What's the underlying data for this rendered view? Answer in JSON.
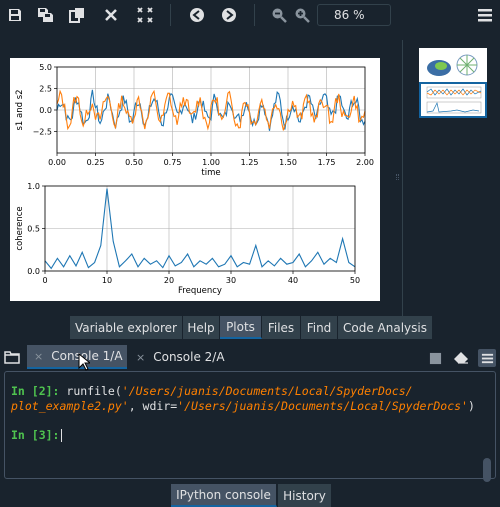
{
  "toolbar": {
    "icons": [
      "save-icon",
      "save-all-icon",
      "copy-icon",
      "close-icon",
      "close-all-icon",
      "previous-icon",
      "next-icon",
      "zoom-out-icon",
      "zoom-in-icon",
      "options-menu-icon"
    ],
    "zoom_value": "86 %"
  },
  "figure": {
    "chart_data": [
      {
        "type": "line",
        "ylabel": "s1 and s2",
        "xlabel": "time",
        "xlim": [
          0,
          2.0
        ],
        "ylim": [
          -5,
          5
        ],
        "xticks": [
          "0.00",
          "0.25",
          "0.50",
          "0.75",
          "1.00",
          "1.25",
          "1.50",
          "1.75",
          "2.00"
        ],
        "yticks": [
          "5.0",
          "2.5",
          "0.0",
          "−2.5"
        ],
        "grid": true,
        "series": [
          {
            "color": "#1f77b4"
          },
          {
            "color": "#ff7f0e"
          }
        ]
      },
      {
        "type": "line",
        "ylabel": "coherence",
        "xlabel": "Frequency",
        "xlim": [
          0,
          50
        ],
        "ylim": [
          0,
          1.0
        ],
        "xticks": [
          "0",
          "10",
          "20",
          "30",
          "40",
          "50"
        ],
        "yticks": [
          "1.0",
          "0.5",
          "0.0"
        ],
        "grid": true,
        "x": [
          0,
          1,
          2,
          3,
          4,
          5,
          6,
          7,
          8,
          9,
          10,
          11,
          12,
          13,
          14,
          15,
          16,
          17,
          18,
          19,
          20,
          21,
          22,
          23,
          24,
          25,
          26,
          27,
          28,
          29,
          30,
          31,
          32,
          33,
          34,
          35,
          36,
          37,
          38,
          39,
          40,
          41,
          42,
          43,
          44,
          45,
          46,
          47,
          48,
          49,
          50
        ],
        "values": [
          0.12,
          0.03,
          0.15,
          0.05,
          0.18,
          0.06,
          0.22,
          0.04,
          0.1,
          0.3,
          0.97,
          0.35,
          0.05,
          0.12,
          0.2,
          0.05,
          0.15,
          0.08,
          0.12,
          0.04,
          0.18,
          0.06,
          0.1,
          0.2,
          0.05,
          0.12,
          0.08,
          0.15,
          0.05,
          0.08,
          0.18,
          0.05,
          0.1,
          0.08,
          0.3,
          0.05,
          0.12,
          0.06,
          0.15,
          0.08,
          0.1,
          0.2,
          0.05,
          0.12,
          0.22,
          0.08,
          0.15,
          0.1,
          0.38,
          0.1,
          0.05
        ],
        "series": [
          {
            "color": "#1f77b4"
          }
        ]
      }
    ]
  },
  "plots_tabs": [
    {
      "label": "Variable explorer",
      "active": false
    },
    {
      "label": "Help",
      "active": false
    },
    {
      "label": "Plots",
      "active": true
    },
    {
      "label": "Files",
      "active": false
    },
    {
      "label": "Find",
      "active": false
    },
    {
      "label": "Code Analysis",
      "active": false
    }
  ],
  "console": {
    "tabs": [
      {
        "label": "Console 1/A",
        "close": "×",
        "active": true
      },
      {
        "label": "Console 2/A",
        "close": "×",
        "active": false
      }
    ],
    "lines": {
      "in2_prompt": "In [2]:",
      "in2_call": " runfile(",
      "in2_path1": "'/Users/juanis/Documents/Local/SpyderDocs/",
      "in2_path2": "plot_example2.py'",
      "in2_mid": ", wdir=",
      "in2_wdir": "'/Users/juanis/Documents/Local/SpyderDocs'",
      "in2_end": ")",
      "in3_prompt": "In [3]:"
    }
  },
  "bottom_tabs": [
    {
      "label": "IPython console",
      "active": true
    },
    {
      "label": "History",
      "active": false
    }
  ]
}
